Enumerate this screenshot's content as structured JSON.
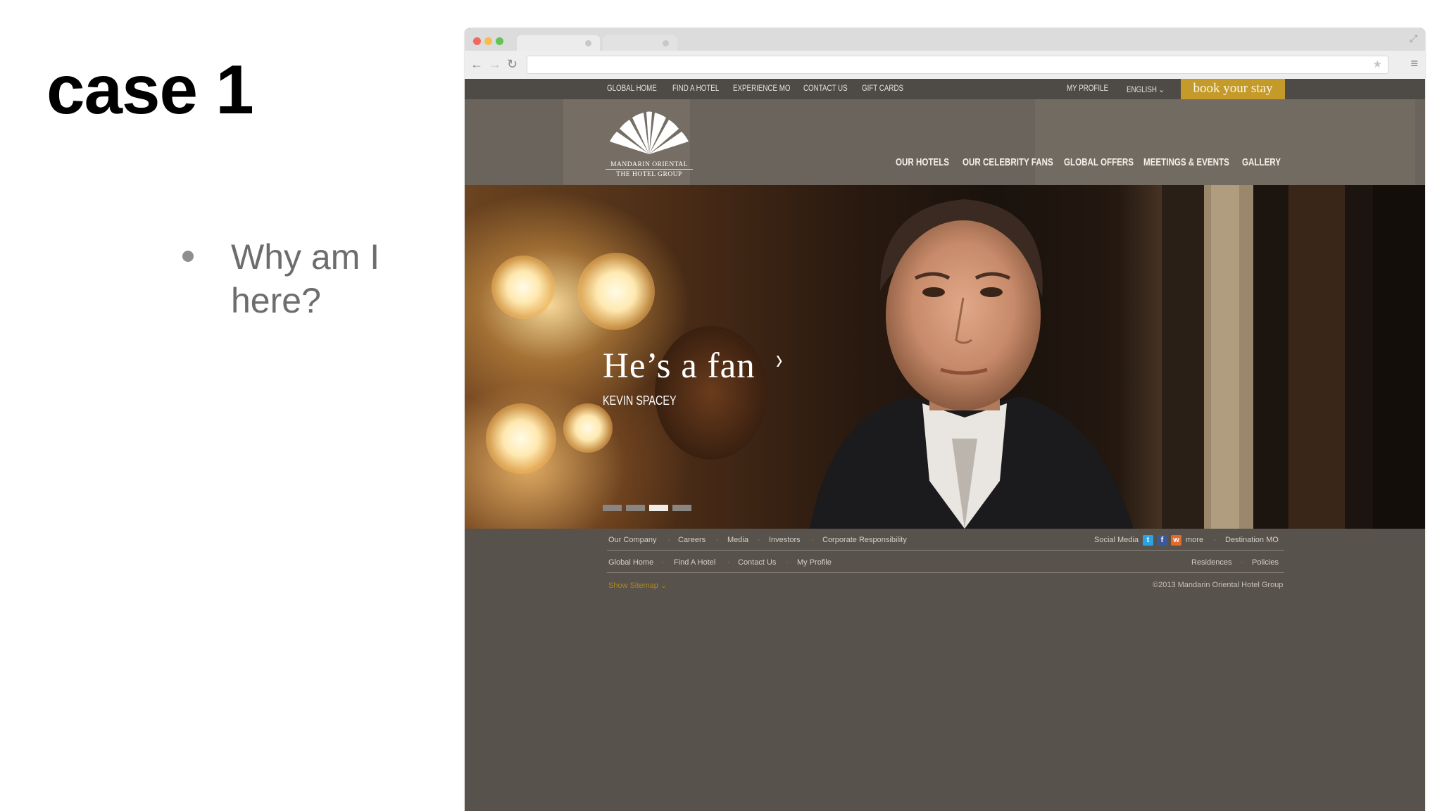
{
  "slide": {
    "title": "case 1",
    "bullets": [
      "Why am I here?"
    ]
  },
  "browser": {
    "url": ""
  },
  "site": {
    "topnav": [
      "GLOBAL HOME",
      "FIND A HOTEL",
      "EXPERIENCE MO",
      "CONTACT US",
      "GIFT CARDS"
    ],
    "topnav_right": [
      "MY PROFILE",
      "ENGLISH"
    ],
    "book_button": "book your stay",
    "logo": {
      "line1": "MANDARIN ORIENTAL",
      "line2": "THE HOTEL GROUP"
    },
    "mainnav": [
      "OUR HOTELS",
      "OUR CELEBRITY FANS",
      "GLOBAL OFFERS",
      "MEETINGS & EVENTS",
      "GALLERY"
    ],
    "hero": {
      "heading": "He’s a fan",
      "arrow": "›",
      "subheading": "KEVIN SPACEY",
      "slides": 4,
      "active_slide": 3
    },
    "footer": {
      "row1_left": [
        "Our Company",
        "Careers",
        "Media",
        "Investors",
        "Corporate Responsibility"
      ],
      "social_label": "Social Media",
      "social_more": "more",
      "row1_right_link": "Destination MO",
      "row2_left": [
        "Global Home",
        "Find A Hotel",
        "Contact Us",
        "My Profile"
      ],
      "row2_right": [
        "Residences",
        "Policies"
      ],
      "sitemap": "Show Sitemap",
      "copyright": "©2013 Mandarin Oriental Hotel Group"
    }
  },
  "colors": {
    "gold": "#c49a2a",
    "site_bg": "#57524c",
    "topnav_bg": "#4e4a45"
  }
}
